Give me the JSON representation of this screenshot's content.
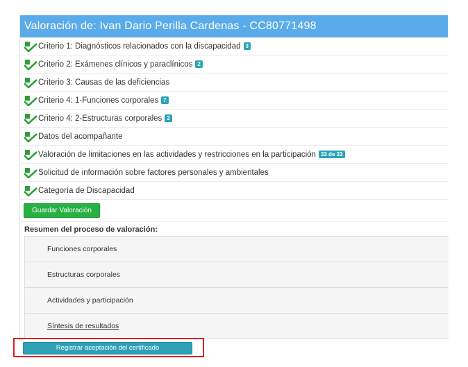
{
  "panel": {
    "title": "Valoración de: Ivan Dario Perilla Cardenas - CC80771498"
  },
  "criteria": [
    {
      "label": "Criterio 1: Diagnósticos relacionados con la discapacidad",
      "badge": "3"
    },
    {
      "label": "Criterio 2: Exámenes clínicos y paraclínicos",
      "badge": "2"
    },
    {
      "label": "Criterio 3: Causas de las deficiencias",
      "badge": ""
    },
    {
      "label": "Criterio 4: 1-Funciones corporales",
      "badge": "7"
    },
    {
      "label": "Criterio 4: 2-Estructuras corporales",
      "badge": "2"
    },
    {
      "label": "Datos del acompañante",
      "badge": ""
    },
    {
      "label": "Valoración de limitaciones en las actividades y restricciones en la participación",
      "badge": "33 de 33"
    },
    {
      "label": "Solicitud de información sobre factores personales y ambientales",
      "badge": ""
    },
    {
      "label": "Categoría de Discapacidad",
      "badge": ""
    }
  ],
  "actions": {
    "save_label": "Guardar Valoración",
    "register_label": "Registrar aceptación del certificado"
  },
  "summary": {
    "title": "Resumen del proceso de valoración:",
    "items": [
      {
        "label": "Funciones corporales"
      },
      {
        "label": "Estructuras corporales"
      },
      {
        "label": "Actividades y participación"
      },
      {
        "label": "Síntesis de resultados"
      }
    ]
  },
  "icons": {
    "criterion_status": "check-pencil-icon"
  },
  "colors": {
    "header": "#5aabe9",
    "check": "#2e9e3a",
    "badge": "#2aa3b8",
    "save_button": "#28b043",
    "register_button": "#2ea1b6",
    "highlight_box": "#e02020"
  }
}
